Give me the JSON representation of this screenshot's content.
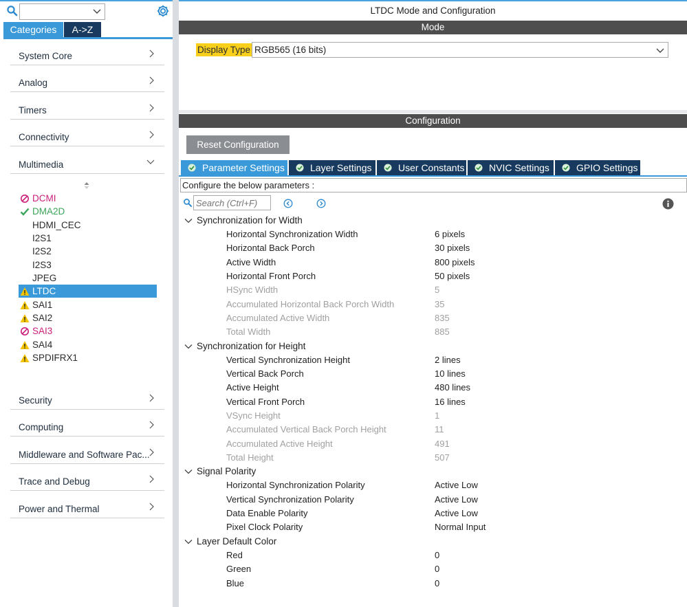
{
  "window_title": "LTDC Mode and Configuration",
  "left": {
    "search_value": "",
    "tabs": [
      "Categories",
      "A->Z"
    ],
    "categories_top": [
      {
        "label": "System Core",
        "expanded": false
      },
      {
        "label": "Analog",
        "expanded": false
      },
      {
        "label": "Timers",
        "expanded": false
      },
      {
        "label": "Connectivity",
        "expanded": false
      },
      {
        "label": "Multimedia",
        "expanded": true
      }
    ],
    "multimedia_items": [
      {
        "label": "DCMI",
        "status": "disabled"
      },
      {
        "label": "DMA2D",
        "status": "ok"
      },
      {
        "label": "HDMI_CEC",
        "status": "none"
      },
      {
        "label": "I2S1",
        "status": "none"
      },
      {
        "label": "I2S2",
        "status": "none"
      },
      {
        "label": "I2S3",
        "status": "none"
      },
      {
        "label": "JPEG",
        "status": "none"
      },
      {
        "label": "LTDC",
        "status": "warning",
        "selected": true
      },
      {
        "label": "SAI1",
        "status": "warning"
      },
      {
        "label": "SAI2",
        "status": "warning"
      },
      {
        "label": "SAI3",
        "status": "disabled"
      },
      {
        "label": "SAI4",
        "status": "warning"
      },
      {
        "label": "SPDIFRX1",
        "status": "warning"
      }
    ],
    "categories_bottom": [
      {
        "label": "Security"
      },
      {
        "label": "Computing"
      },
      {
        "label": "Middleware and Software Pac..."
      },
      {
        "label": "Trace and Debug"
      },
      {
        "label": "Power and Thermal"
      }
    ]
  },
  "mode": {
    "header": "Mode",
    "display_type_label": "Display Type",
    "display_type_value": "RGB565 (16 bits)"
  },
  "config": {
    "header": "Configuration",
    "reset_label": "Reset Configuration",
    "tabs": [
      {
        "label": "Parameter Settings",
        "active": true
      },
      {
        "label": "Layer Settings",
        "active": false
      },
      {
        "label": "User Constants",
        "active": false
      },
      {
        "label": "NVIC Settings",
        "active": false
      },
      {
        "label": "GPIO Settings",
        "active": false
      }
    ],
    "description": "Configure the below parameters :",
    "search_placeholder": "Search (Ctrl+F)",
    "groups": [
      {
        "title": "Synchronization for Width",
        "params": [
          {
            "name": "Horizontal Synchronization Width",
            "value": "6 pixels",
            "readonly": false
          },
          {
            "name": "Horizontal Back Porch",
            "value": "30 pixels",
            "readonly": false
          },
          {
            "name": "Active Width",
            "value": "800 pixels",
            "readonly": false
          },
          {
            "name": "Horizontal Front Porch",
            "value": "50 pixels",
            "readonly": false
          },
          {
            "name": "HSync Width",
            "value": "5",
            "readonly": true
          },
          {
            "name": "Accumulated Horizontal Back Porch Width",
            "value": "35",
            "readonly": true
          },
          {
            "name": "Accumulated Active Width",
            "value": "835",
            "readonly": true
          },
          {
            "name": "Total Width",
            "value": "885",
            "readonly": true
          }
        ]
      },
      {
        "title": "Synchronization for Height",
        "params": [
          {
            "name": "Vertical Synchronization Height",
            "value": "2 lines",
            "readonly": false
          },
          {
            "name": "Vertical Back Porch",
            "value": "10 lines",
            "readonly": false
          },
          {
            "name": "Active Height",
            "value": "480 lines",
            "readonly": false
          },
          {
            "name": "Vertical Front Porch",
            "value": "16 lines",
            "readonly": false
          },
          {
            "name": "VSync Height",
            "value": "1",
            "readonly": true
          },
          {
            "name": "Accumulated Vertical Back Porch Height",
            "value": "11",
            "readonly": true
          },
          {
            "name": "Accumulated Active Height",
            "value": "491",
            "readonly": true
          },
          {
            "name": "Total Height",
            "value": "507",
            "readonly": true
          }
        ]
      },
      {
        "title": "Signal Polarity",
        "params": [
          {
            "name": "Horizontal Synchronization Polarity",
            "value": "Active Low",
            "readonly": false
          },
          {
            "name": "Vertical Synchronization Polarity",
            "value": "Active Low",
            "readonly": false
          },
          {
            "name": "Data Enable Polarity",
            "value": "Active Low",
            "readonly": false
          },
          {
            "name": "Pixel Clock Polarity",
            "value": "Normal Input",
            "readonly": false
          }
        ]
      },
      {
        "title": "Layer Default Color",
        "params": [
          {
            "name": "Red",
            "value": "0",
            "readonly": false
          },
          {
            "name": "Green",
            "value": "0",
            "readonly": false
          },
          {
            "name": "Blue",
            "value": "0",
            "readonly": false
          }
        ]
      }
    ]
  },
  "colors": {
    "accent": "#3a9ad9",
    "tab_dark": "#173a5e",
    "section_bar": "#4e4e4e",
    "highlight_yellow": "#f8d01c",
    "warning": "#f5c400",
    "disabled": "#cc1f7a",
    "ok": "#3aa55a"
  }
}
